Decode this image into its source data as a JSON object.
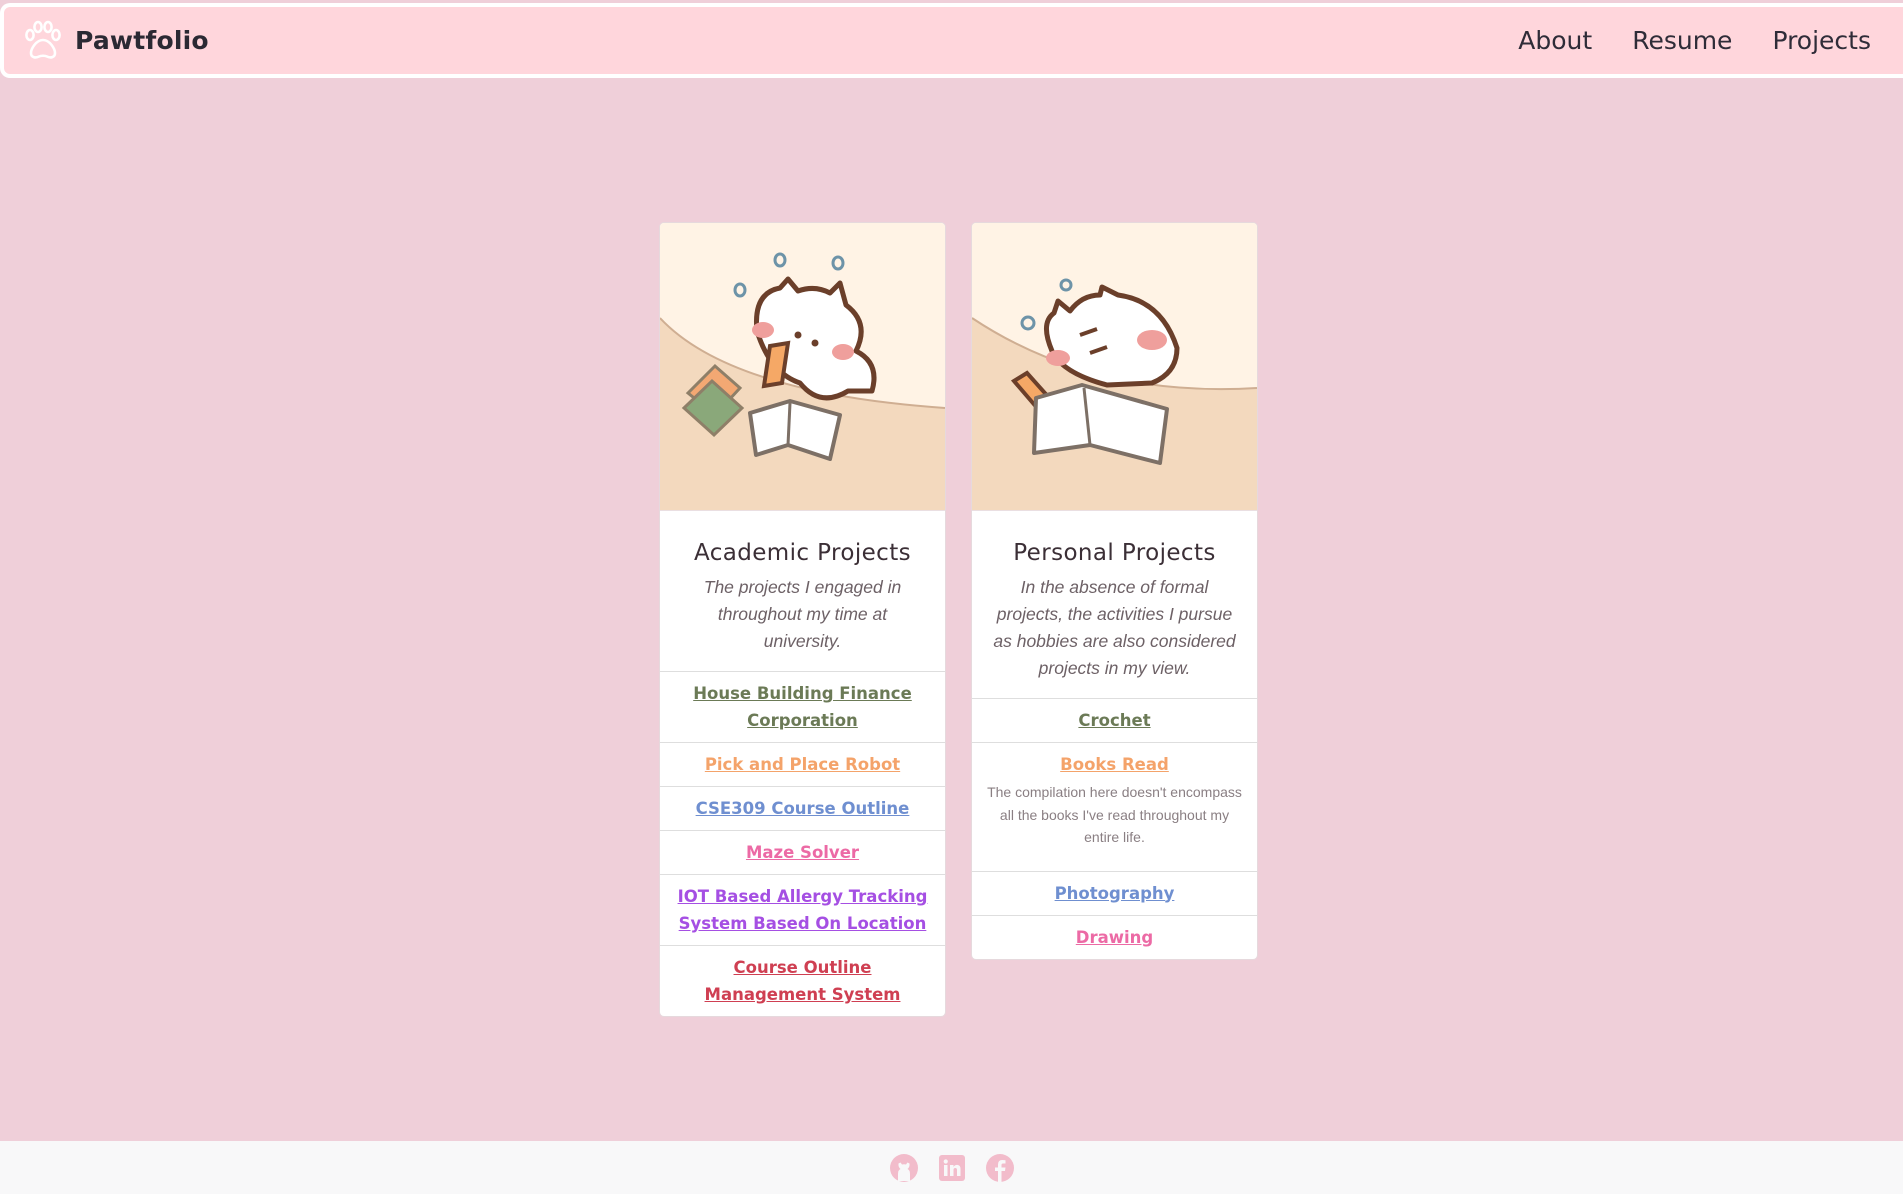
{
  "navbar": {
    "brand": "Pawtfolio",
    "links": [
      "About",
      "Resume",
      "Projects"
    ]
  },
  "academic": {
    "title": "Academic Projects",
    "text": "The projects I engaged in throughout my time at university.",
    "items": [
      {
        "label": "House Building Finance Corporation",
        "color": "#6b7a56"
      },
      {
        "label": "Pick and Place Robot",
        "color": "#f4a36a"
      },
      {
        "label": "CSE309 Course Outline",
        "color": "#6f8fd0"
      },
      {
        "label": "Maze Solver",
        "color": "#ec6aa5"
      },
      {
        "label": "IOT Based Allergy Tracking System Based On Location",
        "color": "#a54fe3"
      },
      {
        "label": "Course Outline Management System",
        "color": "#cf3f52"
      }
    ]
  },
  "personal": {
    "title": "Personal Projects",
    "text": "In the absence of formal projects, the activities I pursue as hobbies are also considered projects in my view.",
    "items": [
      {
        "label": "Crochet",
        "color": "#6b7a56"
      },
      {
        "label": "Books Read",
        "color": "#f4a36a",
        "note": "The compilation here doesn't encompass all the books I've read throughout my entire life."
      },
      {
        "label": "Photography",
        "color": "#6f8fd0"
      },
      {
        "label": "Drawing",
        "color": "#ec6aa5"
      }
    ]
  },
  "footer": {
    "icons": [
      "github-icon",
      "linkedin-icon",
      "facebook-icon"
    ],
    "icon_color": "#f2bccb"
  }
}
